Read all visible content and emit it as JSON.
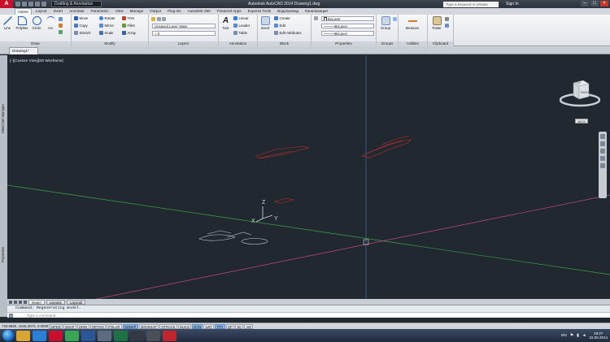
{
  "titlebar": {
    "workspace": "Drafting & Annotation",
    "app_title": "Autodesk AutoCAD 2014   Drawing1.dwg",
    "search_placeholder": "Type a keyword or phrase",
    "sign_in": "Sign In"
  },
  "ribbon_tabs": [
    "Home",
    "Layout",
    "Insert",
    "Annotate",
    "Parametric",
    "View",
    "Manage",
    "Output",
    "Plug-ins",
    "Autodesk 360",
    "Featured Apps",
    "Express Tools",
    "Водопровод",
    "Канализация"
  ],
  "active_tab": "Home",
  "draw": {
    "title": "Draw",
    "line": "Line",
    "polyline": "Polyline",
    "circle": "Circle",
    "arc": "Arc"
  },
  "modify": {
    "title": "Modify",
    "move": "Move",
    "rotate": "Rotate",
    "trim": "Trim",
    "copy": "Copy",
    "mirror": "Mirror",
    "fillet": "Fillet",
    "stretch": "Stretch",
    "scale": "Scale",
    "array": "Array"
  },
  "layers": {
    "title": "Layers",
    "layer_state": "Unsaved Layer State",
    "layer_current": "0"
  },
  "annotation": {
    "title": "Annotation",
    "text": "Text",
    "linear": "Linear",
    "leader": "Leader",
    "table": "Table"
  },
  "block": {
    "title": "Block",
    "insert": "Insert",
    "create": "Create",
    "edit": "Edit",
    "edit_attributes": "Edit Attributes"
  },
  "properties": {
    "title": "Properties",
    "color": "ByLayer",
    "lineweight": "ByLayer",
    "linetype": "ByLayer"
  },
  "groups": {
    "title": "Groups",
    "group": "Group"
  },
  "utilities": {
    "title": "Utilities",
    "measure": "Measure"
  },
  "clipboard": {
    "title": "Clipboard",
    "paste": "Paste"
  },
  "document_tab": "Drawing1*",
  "viewport_label": "[−][Custom View][3D Wireframe]",
  "side_palettes": {
    "sheet_set": "Sheet Set Manager",
    "properties": "Properties"
  },
  "viewcube": {
    "face": "RIGHT",
    "top_label": "TOP",
    "wcs": "WCS"
  },
  "ucs": {
    "x": "X",
    "y": "Y",
    "z": "Z"
  },
  "layout_tabs": [
    "Model",
    "Layout1",
    "Layout2"
  ],
  "command": {
    "history": "Command:  Regenerating model.",
    "placeholder": "Type a command"
  },
  "status": {
    "coords": "733.9826, 1546.3072, 0.0000",
    "toggles": [
      "INFER",
      "SNAP",
      "GRID",
      "ORTHO",
      "POLAR",
      "OSNAP",
      "3DOSNAP",
      "OTRACK",
      "DUCS",
      "DYN",
      "LWT",
      "TPY",
      "QP",
      "SC",
      "AM"
    ],
    "on": [
      "OSNAP",
      "DYN",
      "TPY"
    ]
  },
  "taskbar": {
    "apps": [
      {
        "icon": "explorer-icon",
        "color": "#d9a534"
      },
      {
        "icon": "media-icon",
        "color": "#2c7fd6"
      },
      {
        "icon": "autocad-icon",
        "color": "#c8102e"
      },
      {
        "icon": "chrome-icon",
        "color": "#3aa655"
      },
      {
        "icon": "word-icon",
        "color": "#2b5797"
      },
      {
        "icon": "folder-icon",
        "color": "#5c6b80"
      },
      {
        "icon": "excel-icon",
        "color": "#1e7145"
      },
      {
        "icon": "terminal-icon",
        "color": "#333a45"
      },
      {
        "icon": "app-icon",
        "color": "#4a4f58"
      },
      {
        "icon": "acrobat-icon",
        "color": "#c0262d"
      }
    ],
    "lang": "EN",
    "time": "19:27",
    "date": "22.06.2014"
  }
}
